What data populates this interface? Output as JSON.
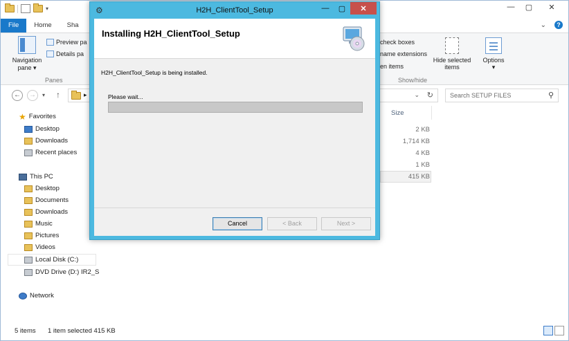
{
  "explorer": {
    "tabs": {
      "file": "File",
      "home": "Home",
      "share": "Sha"
    },
    "ribbon": {
      "navigation_pane": "Navigation pane",
      "preview_pane": "Preview pa",
      "details_pane": "Details pa",
      "panes_group": "Panes",
      "check_boxes": "check boxes",
      "name_extensions": "name extensions",
      "hidden_items": "en items",
      "hide_selected": "Hide selected items",
      "options": "Options",
      "show_hide_group": "Show/hide"
    },
    "search_placeholder": "Search SETUP FILES",
    "sidebar": {
      "favorites": "Favorites",
      "fav_items": [
        "Desktop",
        "Downloads",
        "Recent places"
      ],
      "this_pc": "This PC",
      "pc_items": [
        "Desktop",
        "Documents",
        "Downloads",
        "Music",
        "Pictures",
        "Videos",
        "Local Disk (C:)",
        "DVD Drive (D:) IR2_S"
      ],
      "network": "Network"
    },
    "columns": {
      "size": "Size"
    },
    "sizes": [
      "2 KB",
      "1,714 KB",
      "4 KB",
      "1 KB",
      "415 KB"
    ],
    "status": {
      "items": "5 items",
      "selected": "1 item selected  415 KB"
    }
  },
  "dialog": {
    "title": "H2H_ClientTool_Setup",
    "heading": "Installing H2H_ClientTool_Setup",
    "message": "H2H_ClientTool_Setup is being installed.",
    "wait": "Please wait...",
    "progress": 0,
    "buttons": {
      "cancel": "Cancel",
      "back": "< Back",
      "next": "Next >"
    }
  }
}
